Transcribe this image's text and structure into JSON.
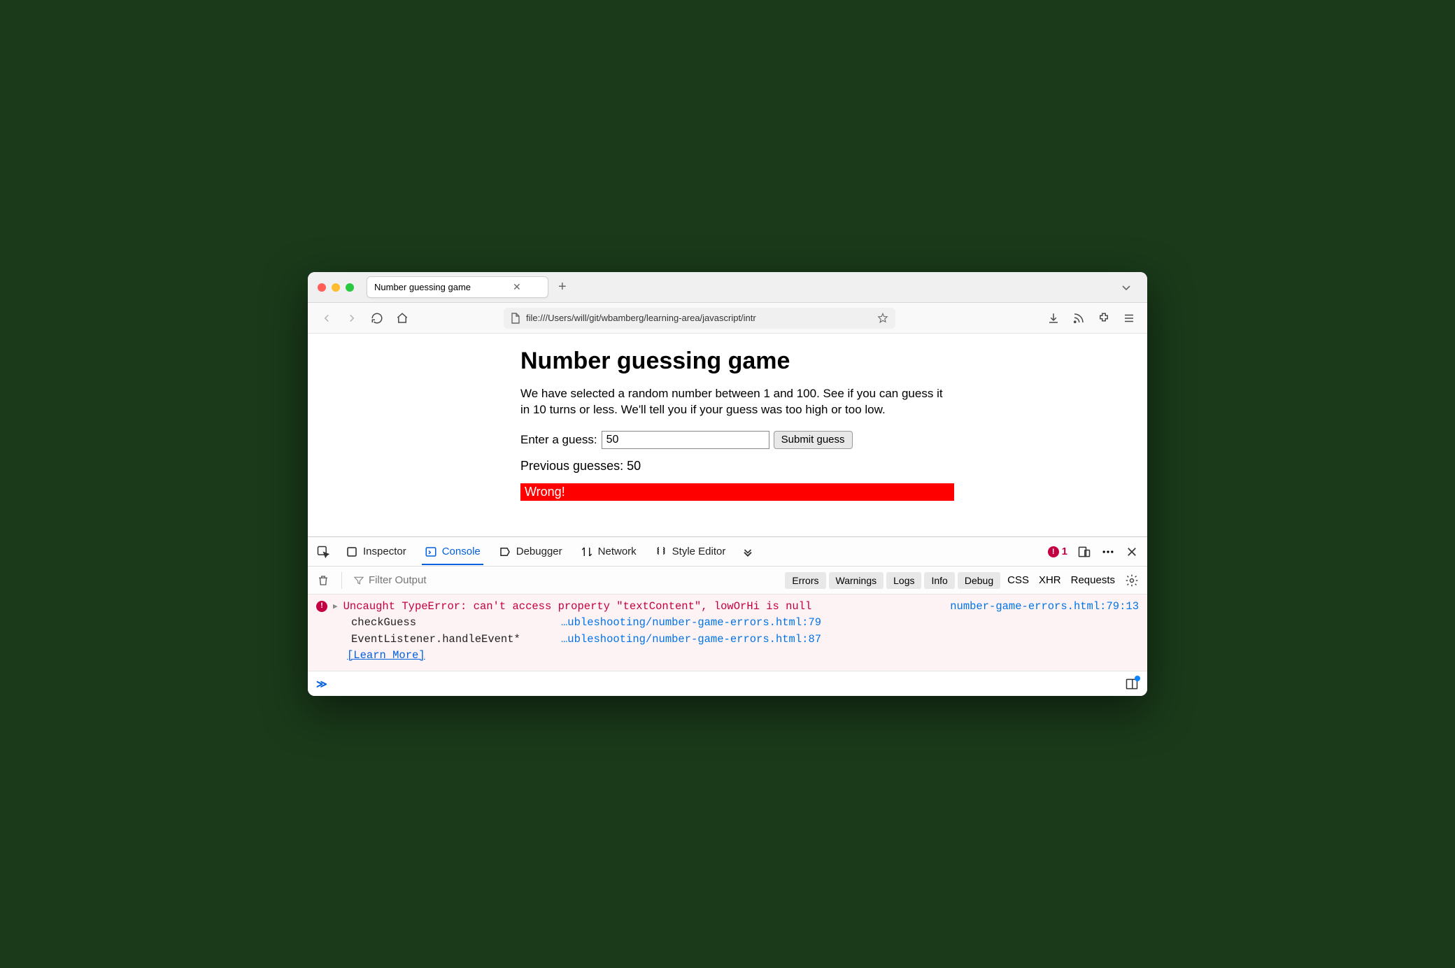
{
  "tab": {
    "title": "Number guessing game"
  },
  "url": "file:///Users/will/git/wbamberg/learning-area/javascript/intr",
  "page": {
    "title": "Number guessing game",
    "description": "We have selected a random number between 1 and 100. See if you can guess it in 10 turns or less. We'll tell you if your guess was too high or too low.",
    "guess_label": "Enter a guess:",
    "guess_value": "50",
    "submit_label": "Submit guess",
    "previous_label": "Previous guesses: 50",
    "result_text": "Wrong!"
  },
  "devtools": {
    "tabs": {
      "inspector": "Inspector",
      "console": "Console",
      "debugger": "Debugger",
      "network": "Network",
      "styleeditor": "Style Editor"
    },
    "error_count": "1",
    "filter_placeholder": "Filter Output",
    "pills": {
      "errors": "Errors",
      "warnings": "Warnings",
      "logs": "Logs",
      "info": "Info",
      "debug": "Debug"
    },
    "filter_right": {
      "css": "CSS",
      "xhr": "XHR",
      "requests": "Requests"
    },
    "error": {
      "message": "Uncaught TypeError: can't access property \"textContent\", lowOrHi is null",
      "source": "number-game-errors.html",
      "line": "79",
      "col": "13",
      "stack": [
        {
          "fn": "checkGuess",
          "path": "…ubleshooting/number-game-errors.html:",
          "ln": "79"
        },
        {
          "fn": "EventListener.handleEvent*",
          "path": "…ubleshooting/number-game-errors.html:",
          "ln": "87"
        }
      ],
      "learn_more": "[Learn More]"
    }
  }
}
